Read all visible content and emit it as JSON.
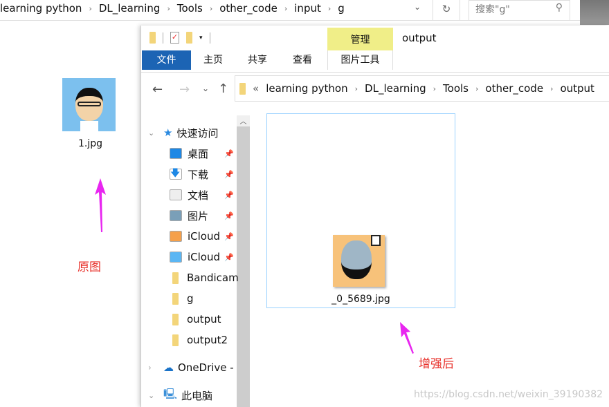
{
  "background_window": {
    "breadcrumb": [
      "learning python",
      "DL_learning",
      "Tools",
      "other_code",
      "input",
      "g"
    ],
    "search_placeholder": "搜索\"g\""
  },
  "desktop": {
    "file_name": "1.jpg",
    "annotation": "原图",
    "arrow_color": "#e826f0",
    "annotation_color": "#e8302a"
  },
  "window": {
    "title": "output",
    "contextual_tab": "管理",
    "contextual_group": "图片工具",
    "tabs": [
      "文件",
      "主页",
      "共享",
      "查看"
    ],
    "address": [
      "learning python",
      "DL_learning",
      "Tools",
      "other_code",
      "output"
    ],
    "nav": {
      "quick_access": "快速访问",
      "items": [
        {
          "label": "桌面",
          "pinned": true,
          "icon": "desktop-icon"
        },
        {
          "label": "下载",
          "pinned": true,
          "icon": "download-icon"
        },
        {
          "label": "文档",
          "pinned": true,
          "icon": "document-icon"
        },
        {
          "label": "图片",
          "pinned": true,
          "icon": "pictures-icon"
        },
        {
          "label": "iCloud",
          "pinned": true,
          "icon": "icloud-photos-icon"
        },
        {
          "label": "iCloud",
          "pinned": true,
          "icon": "icloud-drive-icon"
        },
        {
          "label": "Bandicam",
          "pinned": false,
          "icon": "folder-icon"
        },
        {
          "label": "g",
          "pinned": false,
          "icon": "folder-icon"
        },
        {
          "label": "output",
          "pinned": false,
          "icon": "folder-icon"
        },
        {
          "label": "output2",
          "pinned": false,
          "icon": "folder-icon"
        }
      ],
      "onedrive": "OneDrive -",
      "this_pc": "此电脑"
    },
    "file_name": "_0_5689.jpg",
    "annotation": "增强后"
  },
  "watermark": "https://blog.csdn.net/weixin_39190382"
}
